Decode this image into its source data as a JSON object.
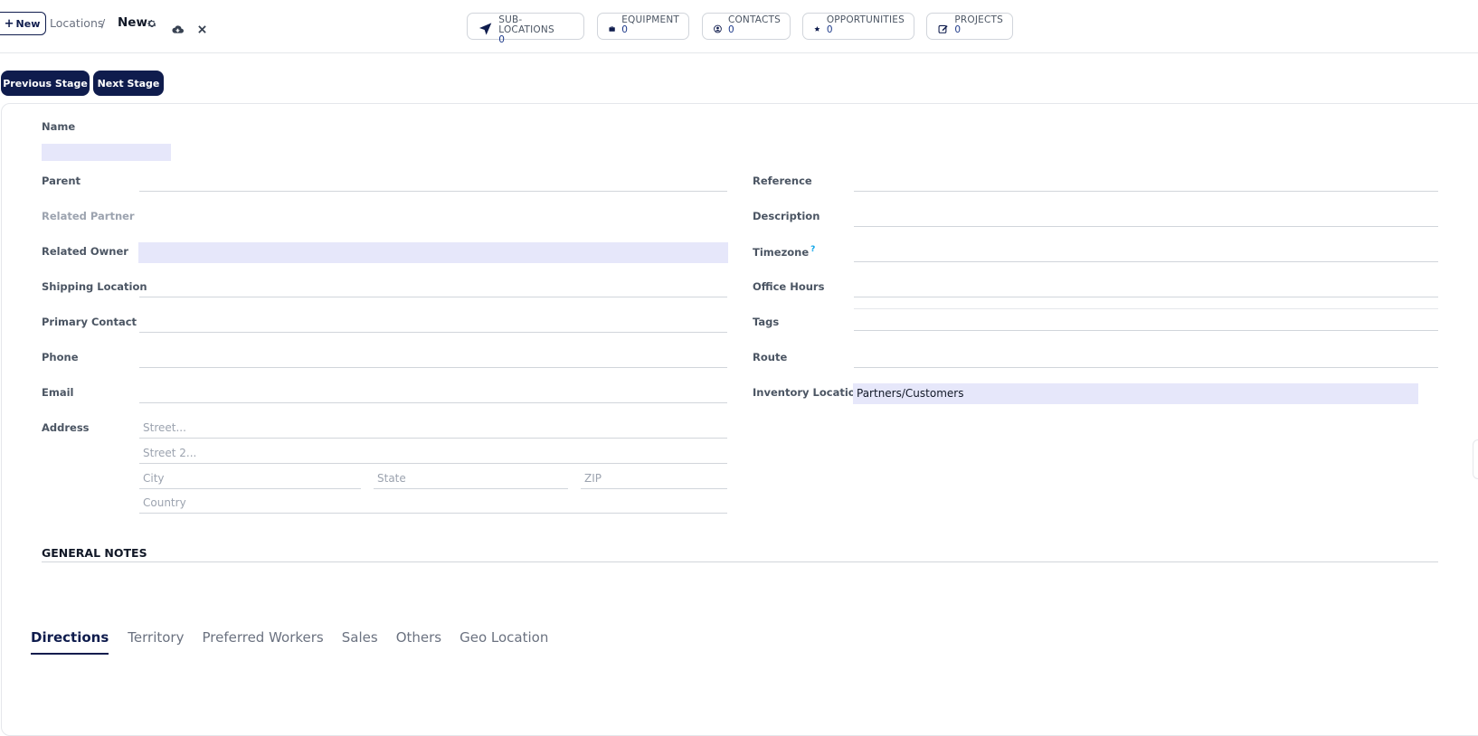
{
  "topbar": {
    "new_button": "New",
    "breadcrumb_parent": "Locations",
    "breadcrumb_separator": "/",
    "current_record": "New"
  },
  "smart_buttons": [
    {
      "label": "SUB-LOCATIONS",
      "value": "0",
      "icon": "location-arrow-icon"
    },
    {
      "label": "EQUIPMENT",
      "value": "0",
      "icon": "briefcase-icon"
    },
    {
      "label": "CONTACTS",
      "value": "0",
      "icon": "user-circle-icon"
    },
    {
      "label": "OPPORTUNITIES",
      "value": "0",
      "icon": "star-icon"
    },
    {
      "label": "PROJECTS",
      "value": "0",
      "icon": "edit-icon"
    }
  ],
  "stage": {
    "previous": "Previous Stage",
    "next": "Next Stage"
  },
  "form": {
    "name_label": "Name",
    "left": {
      "parent": "Parent",
      "related_partner": "Related Partner",
      "related_owner": "Related Owner",
      "shipping_location": "Shipping Location",
      "primary_contact": "Primary Contact",
      "phone": "Phone",
      "email": "Email",
      "address": "Address"
    },
    "address": {
      "street": "Street...",
      "street2": "Street 2...",
      "city": "City",
      "state": "State",
      "zip": "ZIP",
      "country": "Country"
    },
    "right": {
      "reference": "Reference",
      "description": "Description",
      "timezone": "Timezone",
      "timezone_help": "?",
      "office_hours": "Office Hours",
      "tags": "Tags",
      "route": "Route",
      "inventory_location": "Inventory Location",
      "inventory_location_value": "Partners/Customers"
    },
    "general_notes": "GENERAL NOTES"
  },
  "tabs": [
    "Directions",
    "Territory",
    "Preferred Workers",
    "Sales",
    "Others",
    "Geo Location"
  ],
  "colors": {
    "primary": "#0f1c4d",
    "highlight": "#e6e7fa",
    "accent": "#1e3a8a"
  }
}
